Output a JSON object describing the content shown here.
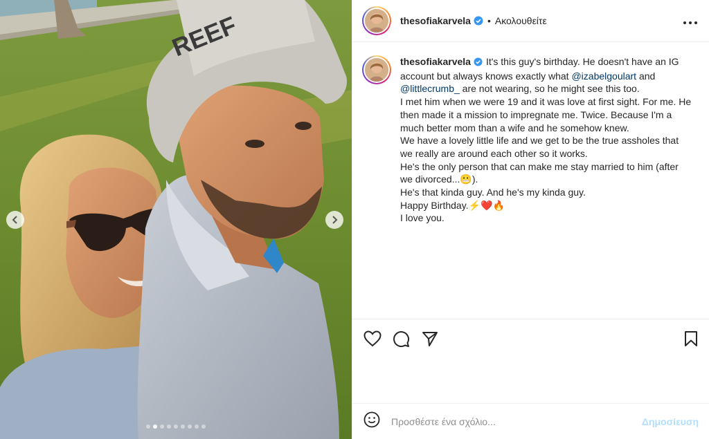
{
  "media": {
    "photo_icon": "selfie-photo",
    "hat_text": "REEF",
    "carousel": {
      "count": 9,
      "active_index": 1
    }
  },
  "header": {
    "username": "thesofiakarvela",
    "separator": "•",
    "follow_status": "Ακολουθείτε",
    "more_icon": "more-horizontal-icon"
  },
  "caption": {
    "username": "thesofiakarvela",
    "lines": [
      [
        "It's this guy's birthday. He doesn't have an IG"
      ],
      [
        "account but always knows exactly what ",
        "@izabelgoulart",
        " and"
      ],
      [
        "@littlecrumb_",
        " are not wearing, so he might see this too."
      ],
      [
        "I met him when we were 19 and it was love at first sight. For me. He"
      ],
      [
        "then made it a mission to impregnate me. Twice. Because I'm a"
      ],
      [
        "much better mom than a wife and he somehow knew."
      ],
      [
        "We have a lovely little life and we get to be the true assholes that"
      ],
      [
        "we really are around each other so it works."
      ],
      [
        "He's the only person that can make me stay married to him (after"
      ],
      [
        "we divorced...",
        "😬",
        ")."
      ],
      [
        "He's that kinda guy. And he's my kinda guy."
      ],
      [
        "Happy Birthday.",
        "⚡❤️🔥"
      ],
      [
        "I love you."
      ]
    ]
  },
  "actions": {
    "like_icon": "heart-icon",
    "comment_icon": "comment-icon",
    "share_icon": "send-icon",
    "save_icon": "bookmark-icon"
  },
  "comment": {
    "emoji_icon": "emoji-icon",
    "placeholder": "Προσθέστε ένα σχόλιο...",
    "post_label": "Δημοσίευση"
  },
  "colors": {
    "mention": "#00376b",
    "verified": "#3897f0",
    "post_disabled": "#b2dffc"
  }
}
